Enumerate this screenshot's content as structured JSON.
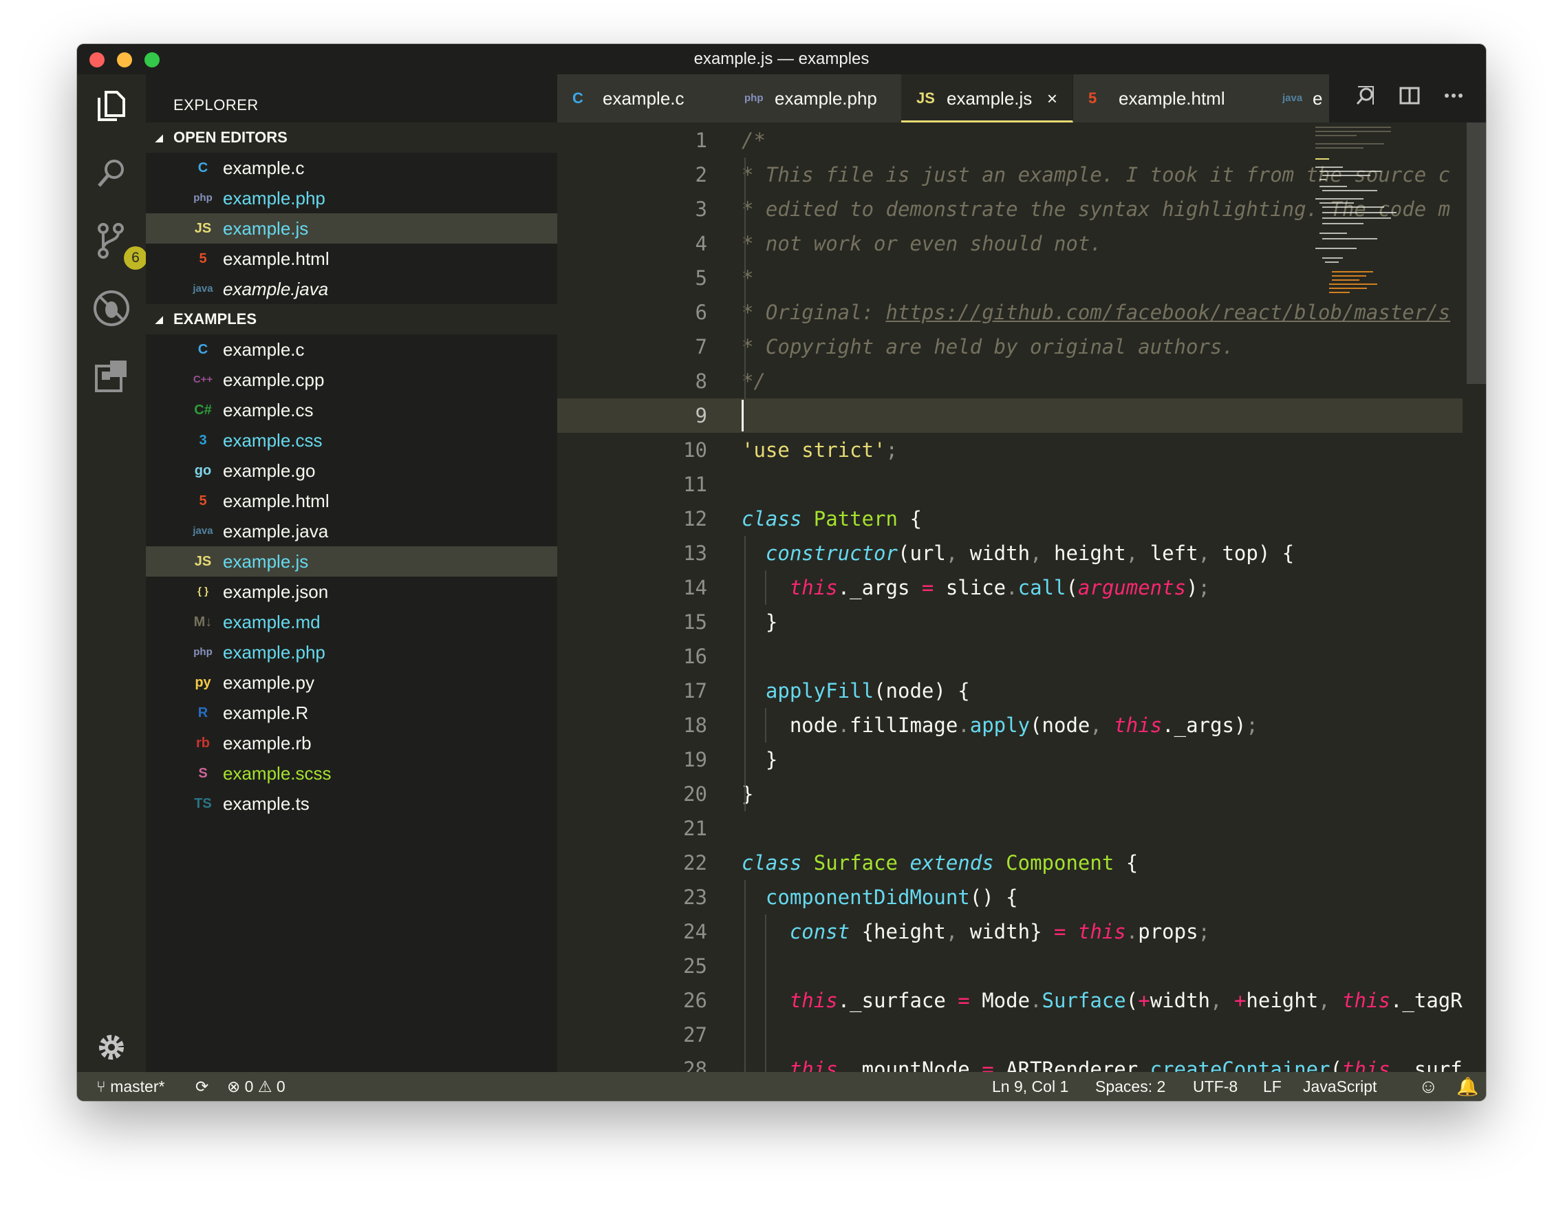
{
  "window": {
    "title": "example.js — examples"
  },
  "activity_bar": {
    "scm_badge": "6"
  },
  "sidebar": {
    "title": "EXPLORER",
    "open_editors_label": "OPEN EDITORS",
    "examples_label": "EXAMPLES",
    "open_editors": [
      {
        "name": "example.c",
        "icon": "C",
        "icon_color": "#3ea7e8",
        "text_color": "#f8f8f2"
      },
      {
        "name": "example.php",
        "icon": "php",
        "icon_color": "#8892bf",
        "text_color": "#66d9ef"
      },
      {
        "name": "example.js",
        "icon": "JS",
        "icon_color": "#e6db74",
        "text_color": "#66d9ef"
      },
      {
        "name": "example.html",
        "icon": "5",
        "icon_color": "#e44d26",
        "text_color": "#f8f8f2"
      },
      {
        "name": "example.java",
        "icon": "java",
        "icon_color": "#5382a1",
        "text_color": "#f8f8f2"
      }
    ],
    "files": [
      {
        "name": "example.c",
        "icon": "C",
        "icon_color": "#3ea7e8",
        "text_color": "#f8f8f2"
      },
      {
        "name": "example.cpp",
        "icon": "C++",
        "icon_color": "#9b4f96",
        "text_color": "#f8f8f2"
      },
      {
        "name": "example.cs",
        "icon": "C#",
        "icon_color": "#2e9c3b",
        "text_color": "#f8f8f2"
      },
      {
        "name": "example.css",
        "icon": "3",
        "icon_color": "#2a9fd6",
        "text_color": "#66d9ef"
      },
      {
        "name": "example.go",
        "icon": "go",
        "icon_color": "#7fd5ea",
        "text_color": "#f8f8f2"
      },
      {
        "name": "example.html",
        "icon": "5",
        "icon_color": "#e44d26",
        "text_color": "#f8f8f2"
      },
      {
        "name": "example.java",
        "icon": "java",
        "icon_color": "#5382a1",
        "text_color": "#f8f8f2"
      },
      {
        "name": "example.js",
        "icon": "JS",
        "icon_color": "#e6db74",
        "text_color": "#66d9ef"
      },
      {
        "name": "example.json",
        "icon": "{ }",
        "icon_color": "#e6db74",
        "text_color": "#f8f8f2"
      },
      {
        "name": "example.md",
        "icon": "M↓",
        "icon_color": "#75715e",
        "text_color": "#66d9ef"
      },
      {
        "name": "example.php",
        "icon": "php",
        "icon_color": "#8892bf",
        "text_color": "#66d9ef"
      },
      {
        "name": "example.py",
        "icon": "py",
        "icon_color": "#f7c948",
        "text_color": "#f8f8f2"
      },
      {
        "name": "example.R",
        "icon": "R",
        "icon_color": "#276dc3",
        "text_color": "#f8f8f2"
      },
      {
        "name": "example.rb",
        "icon": "rb",
        "icon_color": "#cc342d",
        "text_color": "#f8f8f2"
      },
      {
        "name": "example.scss",
        "icon": "S",
        "icon_color": "#cf649a",
        "text_color": "#a6e22e"
      },
      {
        "name": "example.ts",
        "icon": "TS",
        "icon_color": "#2b7489",
        "text_color": "#f8f8f2"
      }
    ]
  },
  "tabs": [
    {
      "label": "example.c",
      "icon": "C",
      "icon_color": "#3ea7e8"
    },
    {
      "label": "example.php",
      "icon": "php",
      "icon_color": "#8892bf"
    },
    {
      "label": "example.js",
      "icon": "JS",
      "icon_color": "#e6db74",
      "close": "×"
    },
    {
      "label": "example.html",
      "icon": "5",
      "icon_color": "#e44d26"
    },
    {
      "label": "e",
      "icon": "java",
      "icon_color": "#5382a1"
    }
  ],
  "editor": {
    "current_line": 9,
    "lines": [
      [
        [
          "cm",
          "/*"
        ]
      ],
      [
        [
          "cm",
          "* This file is just an example. I took it from the source c"
        ]
      ],
      [
        [
          "cm",
          "* edited to demonstrate the syntax highlighting. The code m"
        ]
      ],
      [
        [
          "cm",
          "* not work or even should not."
        ]
      ],
      [
        [
          "cm",
          "*"
        ]
      ],
      [
        [
          "cm",
          "* Original: "
        ],
        [
          "lnk",
          "https://github.com/facebook/react/blob/master/s"
        ]
      ],
      [
        [
          "cm",
          "* Copyright are held by original authors."
        ]
      ],
      [
        [
          "cm",
          "*/"
        ]
      ],
      [],
      [
        [
          "str",
          "'use strict'"
        ],
        [
          "pn",
          ";"
        ]
      ],
      [],
      [
        [
          "kw",
          "class"
        ],
        [
          "txt",
          " "
        ],
        [
          "cls",
          "Pattern"
        ],
        [
          "txt",
          " {"
        ]
      ],
      [
        [
          "txt",
          "  "
        ],
        [
          "kw",
          "constructor"
        ],
        [
          "txt",
          "("
        ],
        [
          "txt",
          "url"
        ],
        [
          "pn",
          ", "
        ],
        [
          "txt",
          "width"
        ],
        [
          "pn",
          ", "
        ],
        [
          "txt",
          "height"
        ],
        [
          "pn",
          ", "
        ],
        [
          "txt",
          "left"
        ],
        [
          "pn",
          ", "
        ],
        [
          "txt",
          "top"
        ],
        [
          "txt",
          ") {"
        ]
      ],
      [
        [
          "txt",
          "    "
        ],
        [
          "self",
          "this"
        ],
        [
          "txt",
          "._args "
        ],
        [
          "op",
          "="
        ],
        [
          "txt",
          " slice"
        ],
        [
          "pn",
          "."
        ],
        [
          "fn2",
          "call"
        ],
        [
          "txt",
          "("
        ],
        [
          "arg",
          "arguments"
        ],
        [
          "txt",
          ")"
        ],
        [
          "pn",
          ";"
        ]
      ],
      [
        [
          "txt",
          "  }"
        ]
      ],
      [],
      [
        [
          "txt",
          "  "
        ],
        [
          "fn2",
          "applyFill"
        ],
        [
          "txt",
          "(node) {"
        ]
      ],
      [
        [
          "txt",
          "    node"
        ],
        [
          "pn",
          "."
        ],
        [
          "txt",
          "fillImage"
        ],
        [
          "pn",
          "."
        ],
        [
          "fn2",
          "apply"
        ],
        [
          "txt",
          "(node"
        ],
        [
          "pn",
          ", "
        ],
        [
          "self",
          "this"
        ],
        [
          "txt",
          "._args)"
        ],
        [
          "pn",
          ";"
        ]
      ],
      [
        [
          "txt",
          "  }"
        ]
      ],
      [
        [
          "txt",
          "}"
        ]
      ],
      [],
      [
        [
          "kw",
          "class"
        ],
        [
          "txt",
          " "
        ],
        [
          "cls",
          "Surface"
        ],
        [
          "txt",
          " "
        ],
        [
          "kw",
          "extends"
        ],
        [
          "txt",
          " "
        ],
        [
          "cls",
          "Component"
        ],
        [
          "txt",
          " {"
        ]
      ],
      [
        [
          "txt",
          "  "
        ],
        [
          "fn2",
          "componentDidMount"
        ],
        [
          "txt",
          "() {"
        ]
      ],
      [
        [
          "txt",
          "    "
        ],
        [
          "kw",
          "const"
        ],
        [
          "txt",
          " {height"
        ],
        [
          "pn",
          ", "
        ],
        [
          "txt",
          "width} "
        ],
        [
          "op",
          "="
        ],
        [
          "txt",
          " "
        ],
        [
          "self",
          "this"
        ],
        [
          "pn",
          "."
        ],
        [
          "txt",
          "props"
        ],
        [
          "pn",
          ";"
        ]
      ],
      [],
      [
        [
          "txt",
          "    "
        ],
        [
          "self",
          "this"
        ],
        [
          "txt",
          "._surface "
        ],
        [
          "op",
          "="
        ],
        [
          "txt",
          " Mode"
        ],
        [
          "pn",
          "."
        ],
        [
          "fn2",
          "Surface"
        ],
        [
          "txt",
          "("
        ],
        [
          "op",
          "+"
        ],
        [
          "txt",
          "width"
        ],
        [
          "pn",
          ", "
        ],
        [
          "op",
          "+"
        ],
        [
          "txt",
          "height"
        ],
        [
          "pn",
          ", "
        ],
        [
          "self",
          "this"
        ],
        [
          "txt",
          "._tagR"
        ]
      ],
      [],
      [
        [
          "txt",
          "    "
        ],
        [
          "self",
          "this"
        ],
        [
          "txt",
          "._mountNode "
        ],
        [
          "op",
          "="
        ],
        [
          "txt",
          " ARTRenderer"
        ],
        [
          "pn",
          "."
        ],
        [
          "fn2",
          "createContainer"
        ],
        [
          "txt",
          "("
        ],
        [
          "self",
          "this"
        ],
        [
          "pn",
          ", "
        ],
        [
          "txt",
          "surf"
        ]
      ]
    ]
  },
  "status_bar": {
    "branch": "master*",
    "errors": "0",
    "warnings": "0",
    "position": "Ln 9, Col 1",
    "spaces": "Spaces: 2",
    "encoding": "UTF-8",
    "eol": "LF",
    "language": "JavaScript"
  },
  "colors": {
    "background": "#272822",
    "sidebar": "#1e1f1c",
    "accent": "#e6db74",
    "status_bar": "#414339"
  }
}
